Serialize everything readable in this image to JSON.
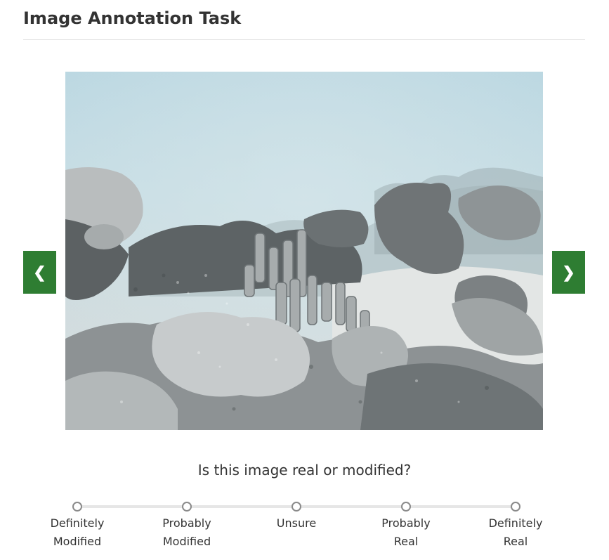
{
  "header": {
    "title": "Image Annotation Task"
  },
  "navigation": {
    "prev_label": "❮",
    "next_label": "❯"
  },
  "image": {
    "icon": "coral-reef-photo"
  },
  "question": {
    "text": "Is this image real or modified?"
  },
  "scale": {
    "options": [
      {
        "line1": "Definitely",
        "line2": "Modified"
      },
      {
        "line1": "Probably",
        "line2": "Modified"
      },
      {
        "line1": "Unsure",
        "line2": ""
      },
      {
        "line1": "Probably",
        "line2": "Real"
      },
      {
        "line1": "Definitely",
        "line2": "Real"
      }
    ],
    "selected": null
  },
  "colors": {
    "accent": "#2e7d32",
    "radio_border": "#8a8a8a",
    "track": "#e6e6e6"
  }
}
